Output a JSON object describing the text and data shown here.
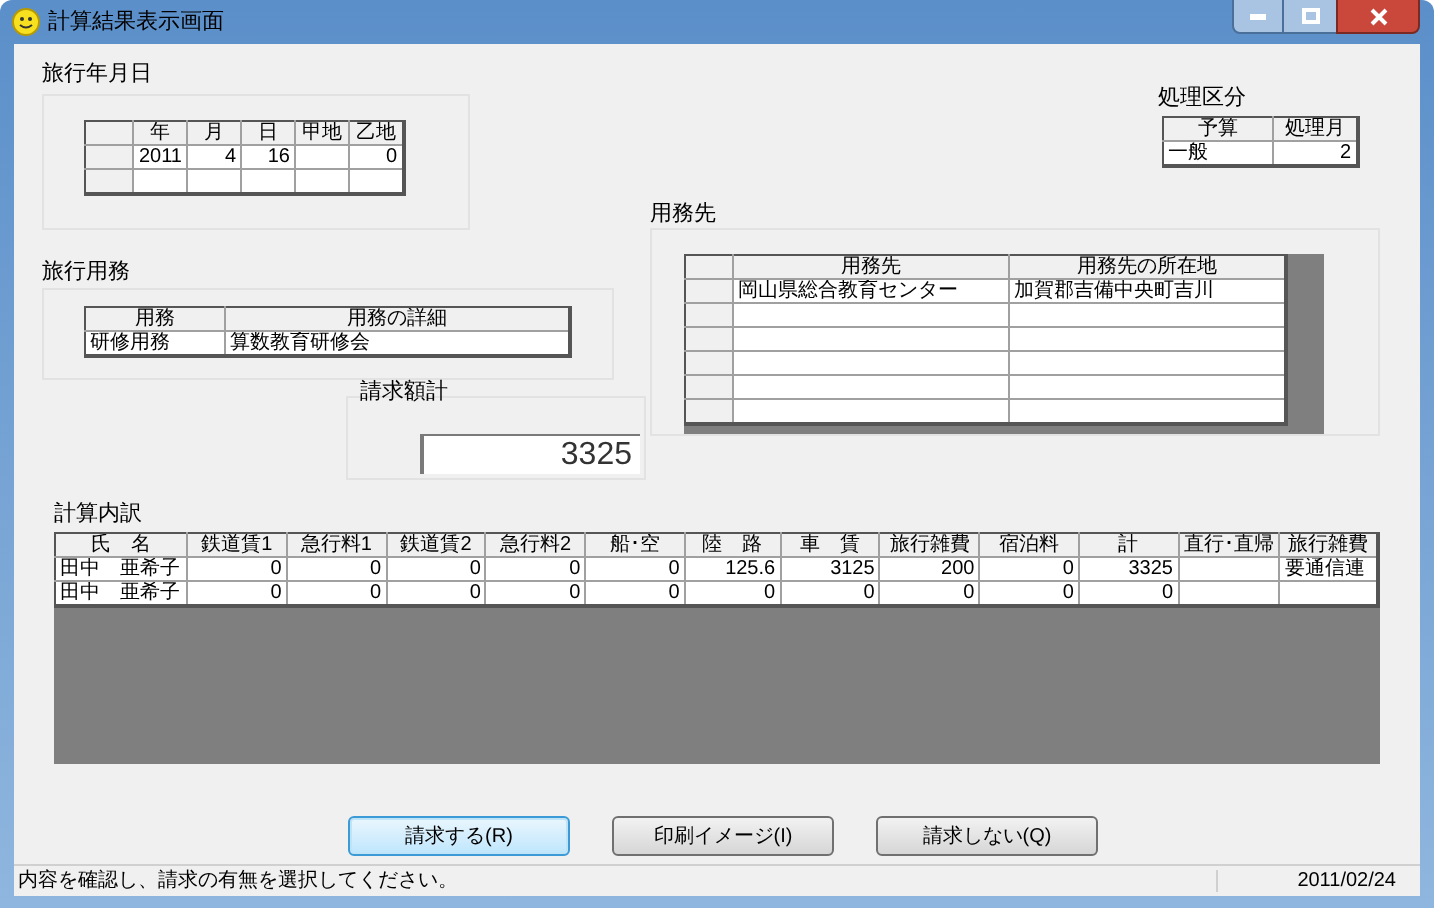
{
  "window": {
    "title": "計算結果表示画面"
  },
  "travel_date": {
    "title": "旅行年月日",
    "columns": [
      "年",
      "月",
      "日",
      "甲地",
      "乙地"
    ],
    "rows": [
      {
        "cells": [
          "2011",
          "4",
          "16",
          null,
          "0"
        ]
      }
    ]
  },
  "travel_purpose": {
    "title": "旅行用務",
    "columns": [
      "用務",
      "用務の詳細"
    ],
    "rows": [
      {
        "cells": [
          "研修用務",
          "算数教育研修会"
        ]
      }
    ]
  },
  "claim_total": {
    "label": "請求額計",
    "value": "3325"
  },
  "processing": {
    "title": "処理区分",
    "columns": [
      "予算",
      "処理月"
    ],
    "rows": [
      {
        "cells": [
          "一般",
          "2"
        ]
      }
    ]
  },
  "destination": {
    "title": "用務先",
    "columns": [
      "用務先",
      "用務先の所在地"
    ],
    "rows": [
      {
        "cells": [
          "岡山県総合教育センター",
          "加賀郡吉備中央町吉川"
        ]
      }
    ]
  },
  "breakdown": {
    "title": "計算内訳",
    "columns": [
      "氏　名",
      "鉄道賃1",
      "急行料1",
      "鉄道賃2",
      "急行料2",
      "船･空",
      "陸　路",
      "車　賃",
      "旅行雑費",
      "宿泊料",
      "計",
      "直行･直帰",
      "旅行雑費"
    ],
    "rows": [
      {
        "cells": [
          "田中　亜希子",
          "0",
          "0",
          "0",
          "0",
          "0",
          "125.6",
          "3125",
          "200",
          "0",
          "3325",
          null,
          "要通信連"
        ]
      },
      {
        "cells": [
          "田中　亜希子",
          "0",
          "0",
          "0",
          "0",
          "0",
          "0",
          "0",
          "0",
          "0",
          "0",
          null,
          null
        ]
      }
    ]
  },
  "buttons": [
    {
      "label": "請求する(R)",
      "default": true
    },
    {
      "label": "印刷イメージ(I)",
      "default": false
    },
    {
      "label": "請求しない(Q)",
      "default": false
    }
  ],
  "status_bar": {
    "message": "内容を確認し、請求の有無を選択してください。",
    "date": "2011/02/24"
  }
}
